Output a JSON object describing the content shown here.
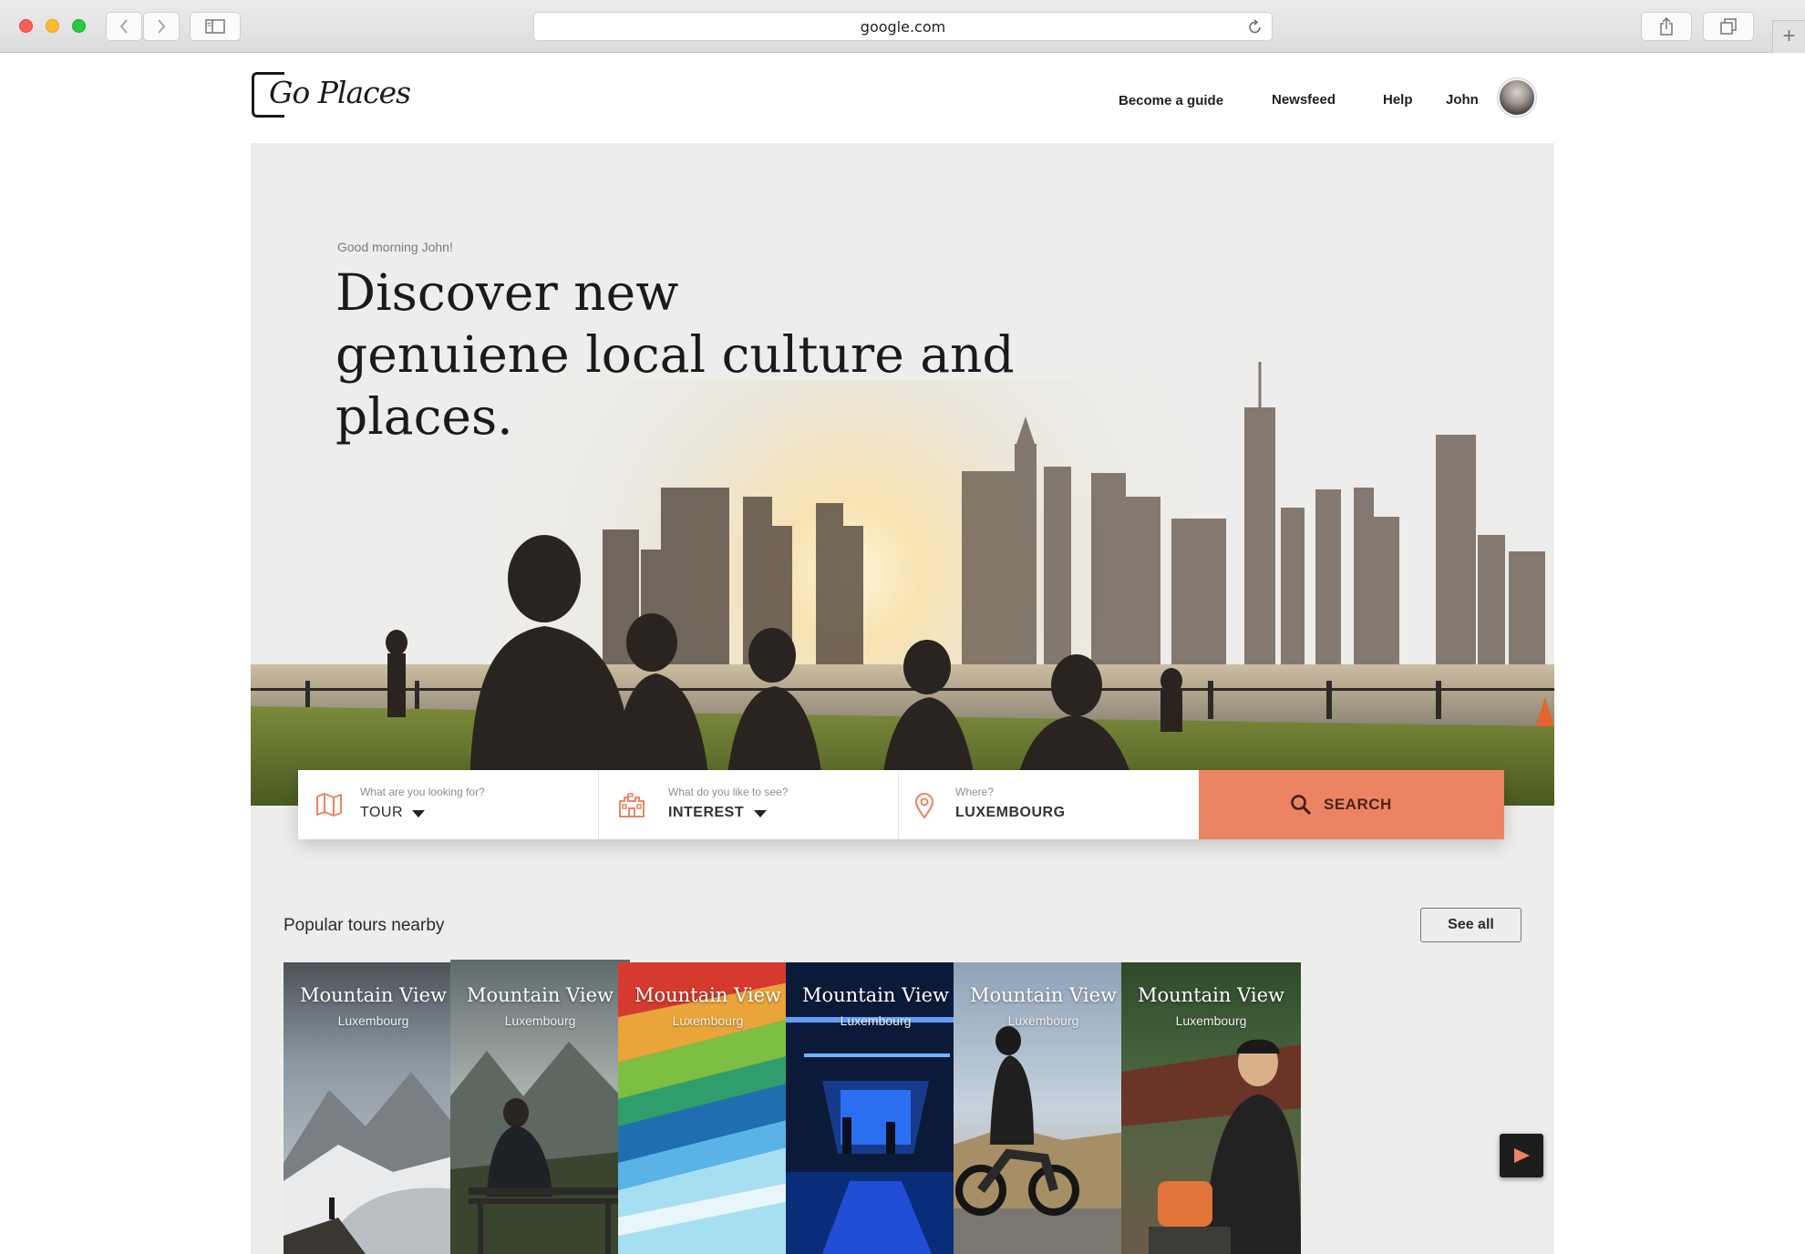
{
  "browser": {
    "url": "google.com"
  },
  "header": {
    "logo_text": "Go Places",
    "nav": [
      "Become a guide",
      "Newsfeed",
      "Help",
      "John"
    ]
  },
  "hero": {
    "greeting": "Good morning John!",
    "headline_lines": [
      "Discover new",
      "genuiene local culture and",
      "places."
    ]
  },
  "search": {
    "fields": [
      {
        "icon": "map-icon",
        "label": "What are you looking for?",
        "value": "TOUR"
      },
      {
        "icon": "castle-icon",
        "label": "What do you like to see?",
        "value": "INTEREST"
      },
      {
        "icon": "location-pin-icon",
        "label": "Where?",
        "value": "LUXEMBOURG"
      }
    ],
    "button_label": "SEARCH",
    "accent_color": "#ec8464"
  },
  "popular": {
    "title": "Popular tours nearby",
    "see_all": "See all",
    "cards": [
      {
        "title": "Mountain View",
        "subtitle": "Luxembourg"
      },
      {
        "title": "Mountain View",
        "subtitle": "Luxembourg"
      },
      {
        "title": "Mountain View",
        "subtitle": "Luxembourg"
      },
      {
        "title": "Mountain View",
        "subtitle": "Luxembourg"
      },
      {
        "title": "Mountain View",
        "subtitle": "Luxembourg"
      },
      {
        "title": "Mountain View",
        "subtitle": "Luxembourg"
      }
    ]
  }
}
